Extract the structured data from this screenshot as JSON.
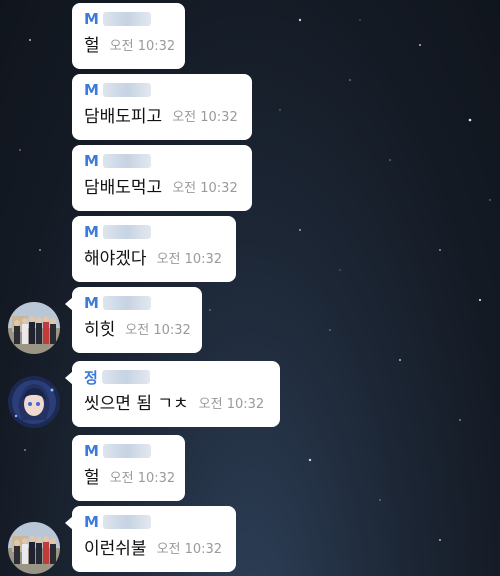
{
  "messages": [
    {
      "sender_initial": "M",
      "text": "헐",
      "time": "오전 10:32"
    },
    {
      "sender_initial": "M",
      "text": "담배도피고",
      "time": "오전 10:32"
    },
    {
      "sender_initial": "M",
      "text": "담배도먹고",
      "time": "오전 10:32"
    },
    {
      "sender_initial": "M",
      "text": "해야겠다",
      "time": "오전 10:32"
    },
    {
      "sender_initial": "M",
      "text": "히힛",
      "time": "오전 10:32"
    },
    {
      "sender_initial": "정",
      "text": "씻으면 됨 ㄱㅊ",
      "time": "오전 10:32"
    },
    {
      "sender_initial": "M",
      "text": "헐",
      "time": "오전 10:32"
    },
    {
      "sender_initial": "M",
      "text": "이런쉬불",
      "time": "오전 10:32"
    }
  ]
}
